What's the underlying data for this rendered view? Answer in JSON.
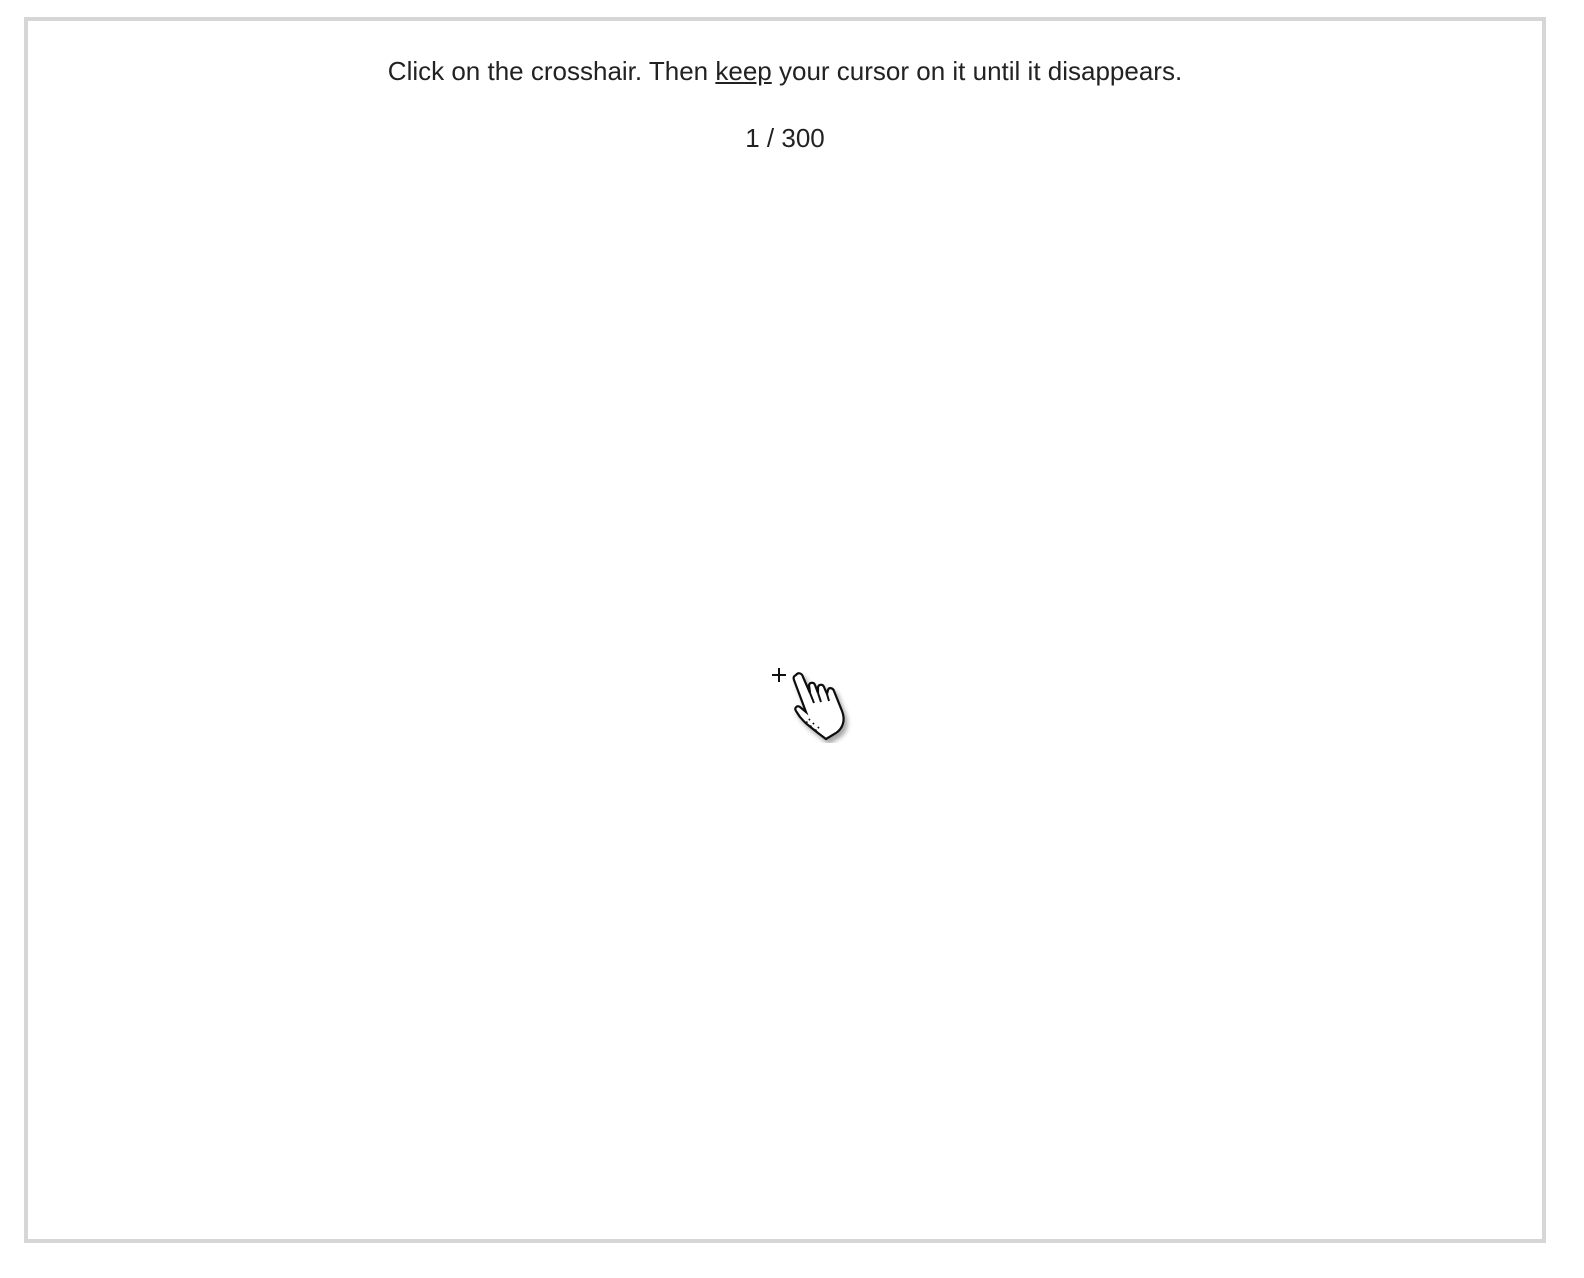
{
  "instruction": {
    "before": "Click on the crosshair. Then ",
    "emphasis": "keep",
    "after": " your cursor on it until it disappears."
  },
  "progress": {
    "current": "1",
    "separator": " / ",
    "total": "300"
  },
  "target": {
    "icon": "crosshair-icon"
  },
  "cursor": {
    "icon": "hand-pointer-icon"
  },
  "colors": {
    "frame_border": "#d6d6d6",
    "text": "#222222",
    "background": "#ffffff"
  }
}
